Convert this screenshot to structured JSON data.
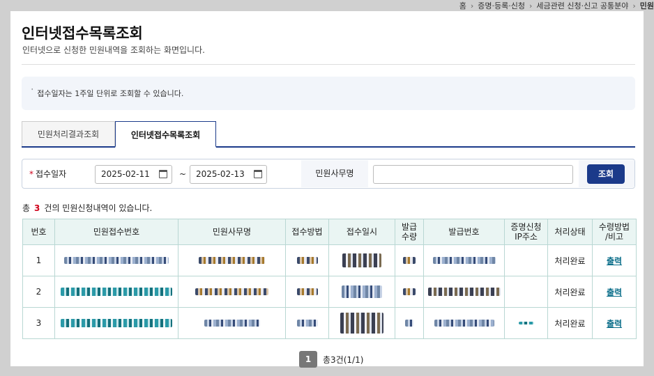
{
  "breadcrumb": {
    "home": "홈",
    "level1": "증명·등록·신청",
    "level2": "세금관련 신청·신고 공통분야",
    "current": "민원"
  },
  "page": {
    "title": "인터넷접수목록조회",
    "subtitle": "인터넷으로 신청한 민원내역을 조회하는 화면입니다.",
    "notice": "접수일자는 1주일 단위로 조회할 수 있습니다."
  },
  "tabs": [
    {
      "label": "민원처리결과조회",
      "active": false
    },
    {
      "label": "인터넷접수목록조회",
      "active": true
    }
  ],
  "search": {
    "required_mark": "*",
    "date_label": "접수일자",
    "date_from": "2025-02-11",
    "date_to": "2025-02-13",
    "range_sep": "~",
    "office_label": "민원사무명",
    "office_value": "",
    "search_button": "조회"
  },
  "result": {
    "prefix": "총",
    "count": "3",
    "suffix": "건의 민원신청내역이 있습니다."
  },
  "table": {
    "headers": [
      "번호",
      "민원접수번호",
      "민원사무명",
      "접수방법",
      "접수일시",
      "발급\n수량",
      "발급번호",
      "증명신청\nIP주소",
      "처리상태",
      "수령방법\n/비고"
    ],
    "rows": [
      {
        "no": "1",
        "status": "처리완료",
        "action": "출력"
      },
      {
        "no": "2",
        "status": "처리완료",
        "action": "출력"
      },
      {
        "no": "3",
        "status": "처리완료",
        "action": "출력"
      }
    ]
  },
  "pagination": {
    "current_page": "1",
    "summary": "총3건(1/1)"
  },
  "colors": {
    "primary": "#1b3a8a",
    "required": "#d0021b",
    "table_header_bg": "#eaf5f3",
    "link": "#0b6e8a"
  }
}
